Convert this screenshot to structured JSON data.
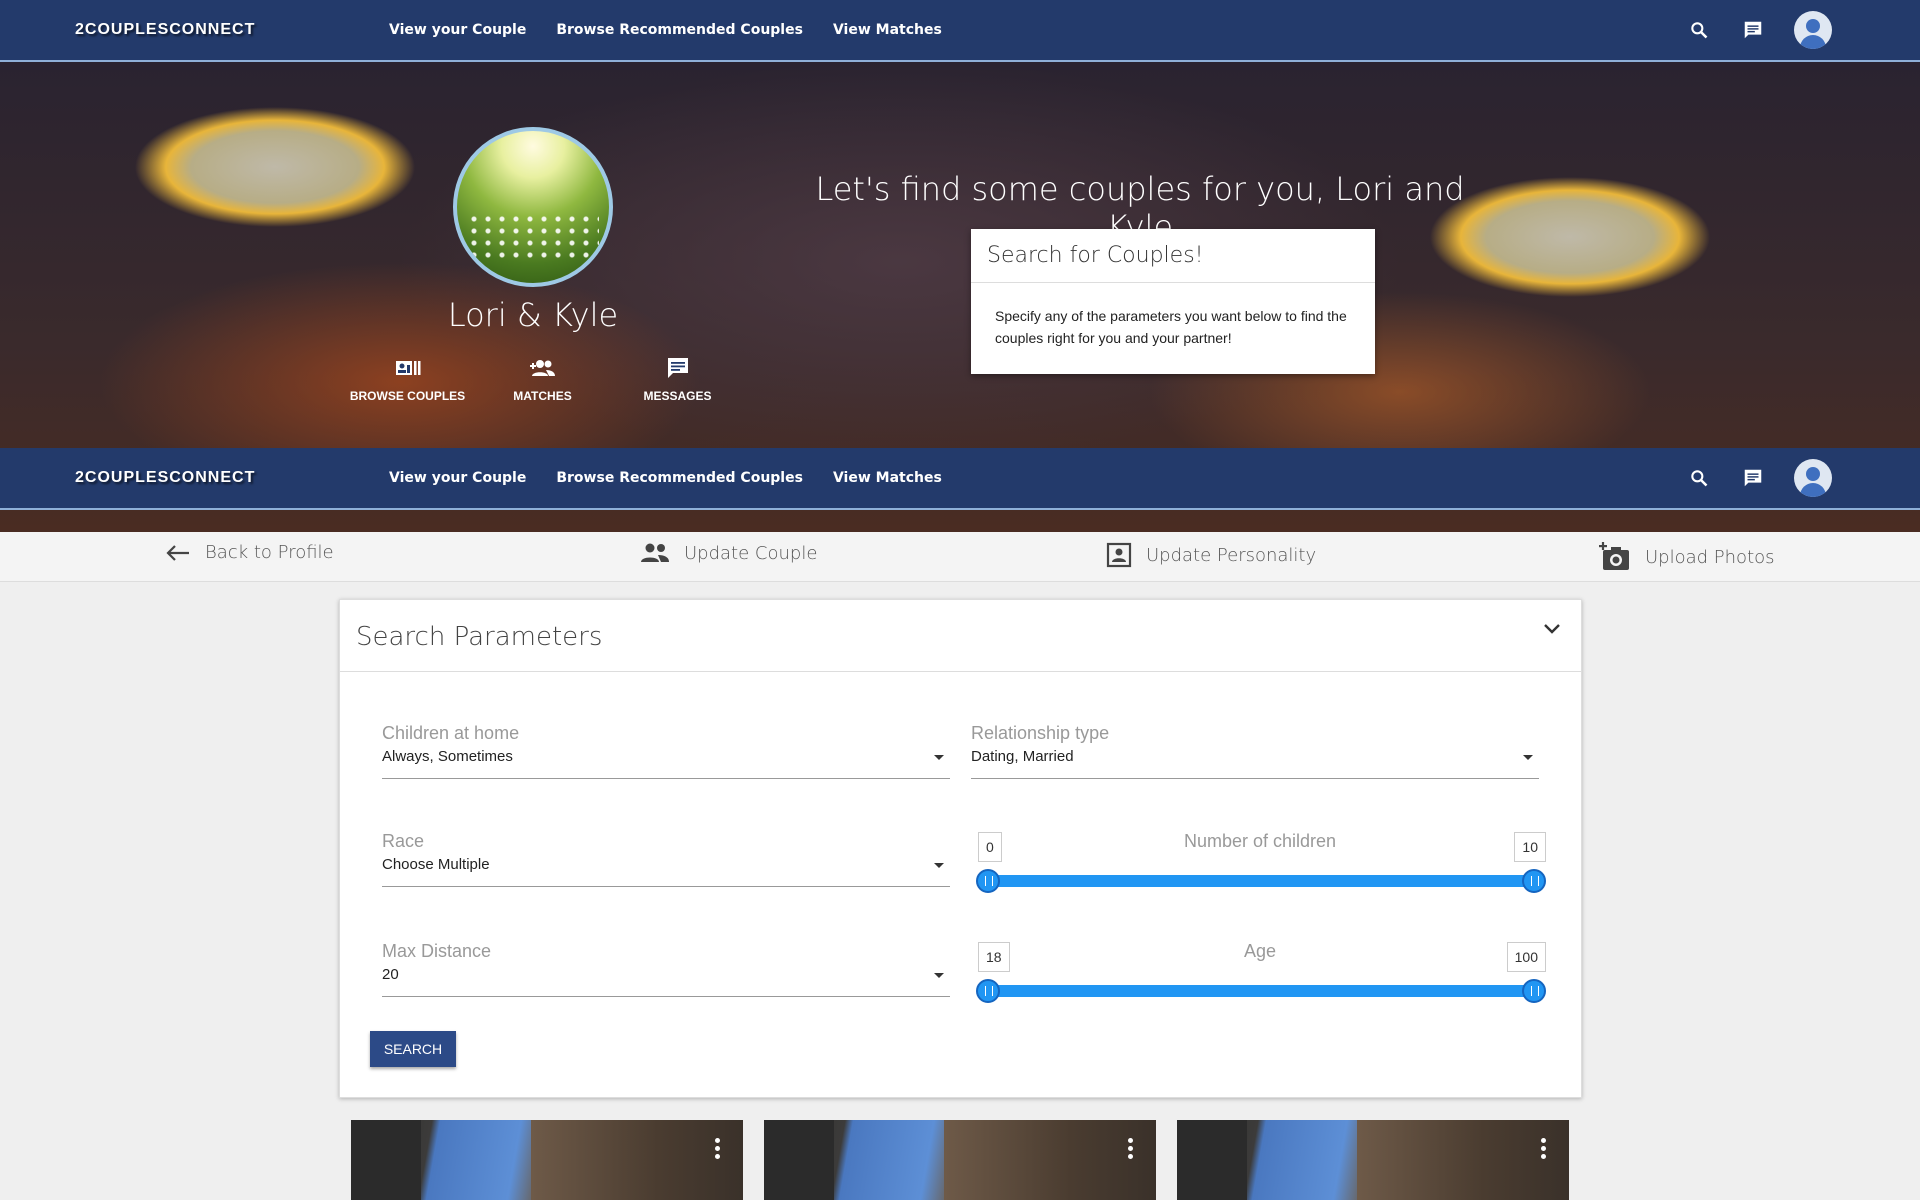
{
  "nav": {
    "brand": "2COUPLESCONNECT",
    "links": [
      "View your Couple",
      "Browse Recommended Couples",
      "View Matches"
    ]
  },
  "hero": {
    "couple_name": "Lori & Kyle",
    "heading": "Let's find some couples for you, Lori and Kyle",
    "quick_links": [
      "BROWSE COUPLES",
      "MATCHES",
      "MESSAGES"
    ],
    "search_card": {
      "title": "Search for Couples!",
      "body": "Specify any of the parameters you want below to find the couples right for you and your partner!"
    }
  },
  "tabs": [
    "Back to Profile",
    "Update Couple",
    "Update Personality",
    "Upload Photos"
  ],
  "params": {
    "title": "Search Parameters",
    "children_at_home": {
      "label": "Children at home",
      "value": "Always, Sometimes"
    },
    "relationship_type": {
      "label": "Relationship type",
      "value": "Dating, Married"
    },
    "race": {
      "label": "Race",
      "value": "Choose Multiple"
    },
    "max_distance": {
      "label": "Max Distance",
      "value": "20"
    },
    "num_children": {
      "label": "Number of children",
      "min": "0",
      "max": "10"
    },
    "age": {
      "label": "Age",
      "min": "18",
      "max": "100"
    },
    "search_button": "SEARCH"
  },
  "colors": {
    "nav": "#233a6b",
    "accent": "#2196f3",
    "button": "#2c4a87"
  },
  "icons": {
    "nav": [
      "search-icon",
      "chat-icon",
      "account-avatar"
    ],
    "quick_links": [
      "browse-couples-icon",
      "matches-icon",
      "messages-icon"
    ],
    "tabs": [
      "arrow-left-icon",
      "people-icon",
      "portrait-icon",
      "add-photo-icon"
    ]
  }
}
